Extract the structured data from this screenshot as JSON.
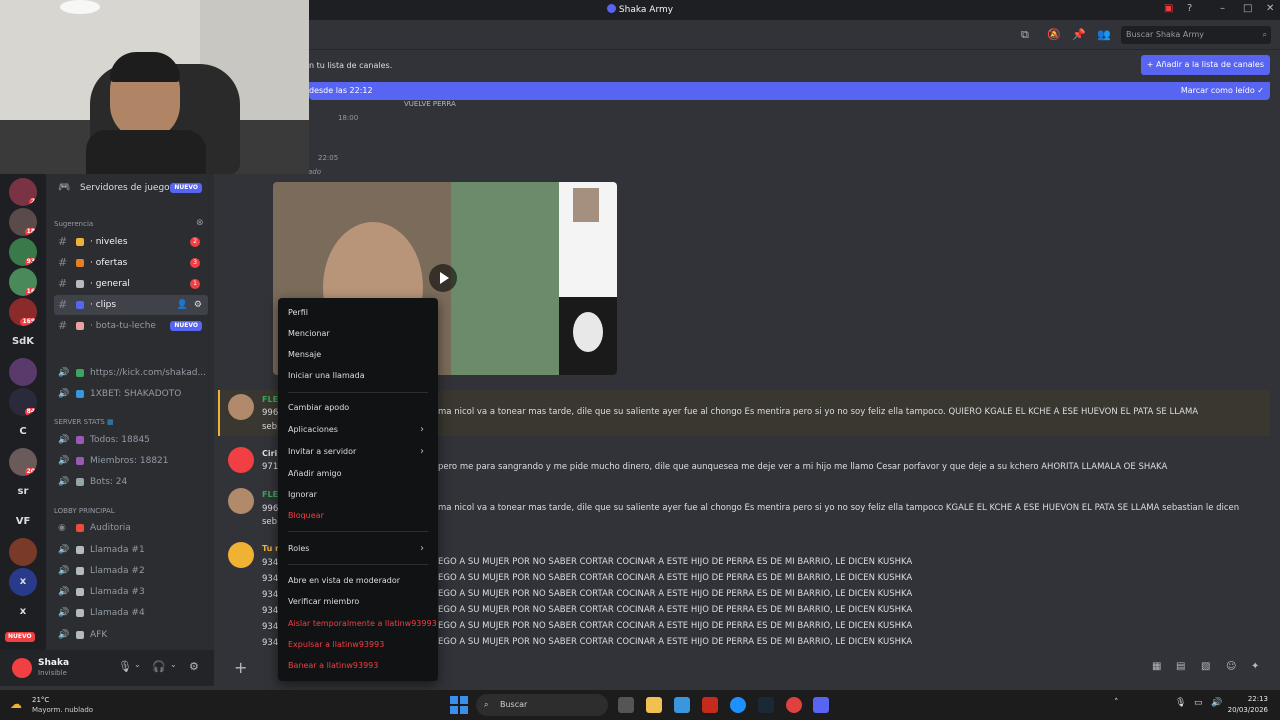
{
  "window": {
    "title": "Shaka Army"
  },
  "colors": {
    "blurple": "#5865f2",
    "danger": "#f23f43",
    "mention_highlight": "#39372f",
    "mention_bar": "#f0b232",
    "background": "#313338",
    "sidebar": "#2b2d31"
  },
  "header": {
    "search_placeholder": "Buscar Shaka Army"
  },
  "banner": {
    "join_text": "n tu lista de canales.",
    "add_button": "+ Añadir a la lista de canales",
    "new_since": "desde las 22:12",
    "mark_read": "Marcar como leído"
  },
  "rail": {
    "servers": [
      {
        "label": "",
        "badge": "2"
      },
      {
        "label": "",
        "badge": "18"
      },
      {
        "label": "",
        "badge": "93"
      },
      {
        "label": "",
        "badge": "16"
      },
      {
        "label": "",
        "badge": "169"
      },
      {
        "label": "SdK",
        "badge": ""
      },
      {
        "label": "",
        "badge": ""
      },
      {
        "label": "",
        "badge": "84"
      },
      {
        "label": "C",
        "badge": ""
      },
      {
        "label": "",
        "badge": "20"
      },
      {
        "label": "sr",
        "badge": ""
      },
      {
        "label": "VF",
        "badge": ""
      },
      {
        "label": "",
        "badge": ""
      },
      {
        "label": "x",
        "badge": ""
      }
    ],
    "new_label": "NUEVO"
  },
  "sidebar": {
    "game_servers": {
      "label": "Servidores de juegos",
      "badge": "NUEVO"
    },
    "category_suggestion": "Sugerencia",
    "channels": [
      {
        "label": "· niveles",
        "count": "2"
      },
      {
        "label": "· ofertas",
        "count": "3"
      },
      {
        "label": "· general",
        "count": "1"
      },
      {
        "label": "· clips",
        "count": ""
      },
      {
        "label": "· bota-tu-leche",
        "badge": "NUEVO"
      }
    ],
    "links": [
      {
        "label": "https://kick.com/shakad..."
      },
      {
        "label": "1XBET: SHAKADOTO"
      }
    ],
    "server_stats_label": "SERVER STATS",
    "stats": [
      {
        "label": "Todos: 18845"
      },
      {
        "label": "Miembros: 18821"
      },
      {
        "label": "Bots: 24"
      }
    ],
    "lobby_label": "LOBBY PRINCIPAL",
    "voice": [
      {
        "label": "Auditoria"
      },
      {
        "label": "Llamada #1"
      },
      {
        "label": "Llamada #2"
      },
      {
        "label": "Llamada #3"
      },
      {
        "label": "Llamada #4"
      },
      {
        "label": "AFK"
      }
    ]
  },
  "user": {
    "name": "Shaka",
    "status": "Invisible"
  },
  "messages": {
    "top_line": "VUELVE PERRA",
    "top_time": "18:00",
    "second_time": "22:05",
    "forwarded": "Reenviado",
    "rows": [
      {
        "user": "FLE",
        "sub1": "996",
        "sub2": "seb",
        "text": "ma nicol  va a tonear mas tarde,  dile que su saliente ayer fue al chongo   Es mentira pero si yo  no soy feliz ella tampoco. QUIERO  KGALE EL KCHE A ESE HUEVON EL PATA SE LLAMA"
      },
      {
        "user": "Ciri",
        "sub1": "971",
        "sub2": "",
        "text": "pero me para sangrando y me pide mucho dinero, dile que aunquesea me deje ver a mi hijo me llamo Cesar porfavor y que deje a su kchero AHORITA LLAMALA OE SHAKA"
      },
      {
        "user": "FLE",
        "sub1": "996",
        "sub2": "seb",
        "text": "ma nicol  va a tonear mas tarde,  dile que su saliente ayer fue al chongo   Es mentira pero si yo  no soy feliz ella tampoco  KGALE EL KCHE A ESE HUEVON EL PATA SE LLAMA   sebastian le dicen"
      },
      {
        "user": "Tu n",
        "sub1": "934",
        "sub2": "",
        "text": "EGO A SU MUJER POR NO SABER CORTAR COCINAR A ESTE HIJO DE PERRA ES DE MI BARRIO, LE DICEN KUSHKA"
      }
    ],
    "repeat_prefix": "934",
    "repeat_text": "EGO A SU MUJER POR NO SABER CORTAR COCINAR A ESTE HIJO DE PERRA ES DE MI BARRIO, LE DICEN KUSHKA"
  },
  "context_menu": {
    "items": [
      {
        "label": "Perfil"
      },
      {
        "label": "Mencionar"
      },
      {
        "label": "Mensaje"
      },
      {
        "label": "Iniciar una llamada"
      },
      {
        "label": "Cambiar apodo"
      },
      {
        "label": "Aplicaciones"
      },
      {
        "label": "Invitar a servidor"
      },
      {
        "label": "Añadir amigo"
      },
      {
        "label": "Ignorar"
      },
      {
        "label": "Bloquear"
      },
      {
        "label": "Roles"
      },
      {
        "label": "Abre en vista de moderador"
      },
      {
        "label": "Verificar miembro"
      },
      {
        "label": "Aislar temporalmente a llatinw93993"
      },
      {
        "label": "Expulsar a llatinw93993"
      },
      {
        "label": "Banear a llatinw93993"
      }
    ]
  },
  "taskbar": {
    "temperature": "21°C",
    "weather": "Mayorm. nublado",
    "search": "Buscar",
    "time": "22:13",
    "date": "20/03/2026"
  }
}
